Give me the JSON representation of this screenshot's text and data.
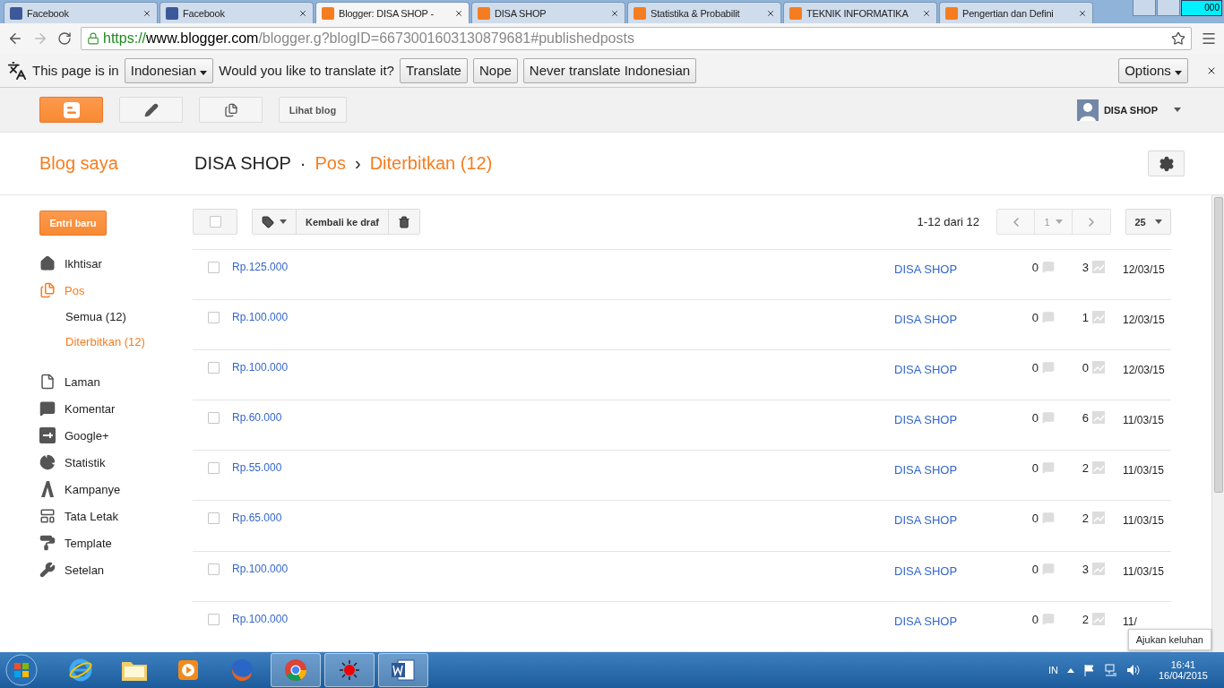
{
  "browser": {
    "tabs": [
      {
        "title": "Facebook",
        "kind": "facebook",
        "selected": false
      },
      {
        "title": "Facebook",
        "kind": "facebook",
        "selected": false
      },
      {
        "title": "Blogger: DISA SHOP -",
        "kind": "blogger",
        "selected": true
      },
      {
        "title": "DISA SHOP",
        "kind": "blogger",
        "selected": false
      },
      {
        "title": "Statistika & Probabilit",
        "kind": "blogger",
        "selected": false
      },
      {
        "title": "TEKNIK INFORMATIKA",
        "kind": "blogger",
        "selected": false
      },
      {
        "title": "Pengertian dan Defini",
        "kind": "blogger",
        "selected": false
      }
    ],
    "indicator_text": "000",
    "url": {
      "scheme": "https://",
      "host": "www.blogger.com",
      "path": "/blogger.g?blogID=6673001603130879681#publishedposts"
    },
    "translate_bar": {
      "lead": "This page is in",
      "language": "Indonesian",
      "question": "Would you like to translate it?",
      "buttons": [
        "Translate",
        "Nope",
        "Never translate Indonesian"
      ],
      "options": "Options"
    }
  },
  "header": {
    "view_blog": "Lihat blog",
    "account": "DISA SHOP"
  },
  "title_bar": {
    "my_blogs": "Blog saya",
    "blog": "DISA SHOP",
    "separator": "·",
    "section": "Pos",
    "arrow": "›",
    "page": "Diterbitkan (12)"
  },
  "sidebar": {
    "new_post": "Entri baru",
    "items": [
      {
        "label": "Ikhtisar",
        "kind": "home",
        "selected": false
      },
      {
        "label": "Pos",
        "kind": "posts",
        "selected": true,
        "children": [
          {
            "label": "Semua (12)",
            "selected": false
          },
          {
            "label": "Diterbitkan (12)",
            "selected": true
          }
        ]
      },
      {
        "label": "Laman",
        "kind": "page",
        "selected": false
      },
      {
        "label": "Komentar",
        "kind": "comment",
        "selected": false
      },
      {
        "label": "Google+",
        "kind": "gplus",
        "selected": false
      },
      {
        "label": "Statistik",
        "kind": "pie",
        "selected": false
      },
      {
        "label": "Kampanye",
        "kind": "campaign",
        "selected": false
      },
      {
        "label": "Tata Letak",
        "kind": "layout",
        "selected": false
      },
      {
        "label": "Template",
        "kind": "roller",
        "selected": false
      },
      {
        "label": "Setelan",
        "kind": "wrench",
        "selected": false
      }
    ]
  },
  "toolbar": {
    "select_all_checked": false,
    "revert": "Kembali ke draf",
    "range": "1-12 dari 12",
    "page": "1",
    "per_page": "25"
  },
  "posts": [
    {
      "title": "Rp.125.000",
      "author": "DISA SHOP",
      "comments": "0",
      "views": "3",
      "date": "12/03/15",
      "checked": false
    },
    {
      "title": "Rp.100.000",
      "author": "DISA SHOP",
      "comments": "0",
      "views": "1",
      "date": "12/03/15",
      "checked": false
    },
    {
      "title": "Rp.100.000",
      "author": "DISA SHOP",
      "comments": "0",
      "views": "0",
      "date": "12/03/15",
      "checked": false
    },
    {
      "title": "Rp.60.000",
      "author": "DISA SHOP",
      "comments": "0",
      "views": "6",
      "date": "11/03/15",
      "checked": false
    },
    {
      "title": "Rp.55.000",
      "author": "DISA SHOP",
      "comments": "0",
      "views": "2",
      "date": "11/03/15",
      "checked": false
    },
    {
      "title": "Rp.65.000",
      "author": "DISA SHOP",
      "comments": "0",
      "views": "2",
      "date": "11/03/15",
      "checked": false
    },
    {
      "title": "Rp.100.000",
      "author": "DISA SHOP",
      "comments": "0",
      "views": "3",
      "date": "11/03/15",
      "checked": false
    },
    {
      "title": "Rp.100.000",
      "author": "DISA SHOP",
      "comments": "0",
      "views": "2",
      "date": "11/",
      "checked": false
    }
  ],
  "tooltip": "Ajukan keluhan",
  "taskbar": {
    "apps": [
      {
        "kind": "ie",
        "active": false
      },
      {
        "kind": "folder",
        "active": false
      },
      {
        "kind": "media",
        "active": false
      },
      {
        "kind": "firefox",
        "active": false
      },
      {
        "kind": "chrome",
        "active": true
      },
      {
        "kind": "recorder",
        "active": true
      },
      {
        "kind": "word",
        "active": true
      }
    ],
    "language": "IN",
    "time": "16:41",
    "date": "16/04/2015"
  }
}
